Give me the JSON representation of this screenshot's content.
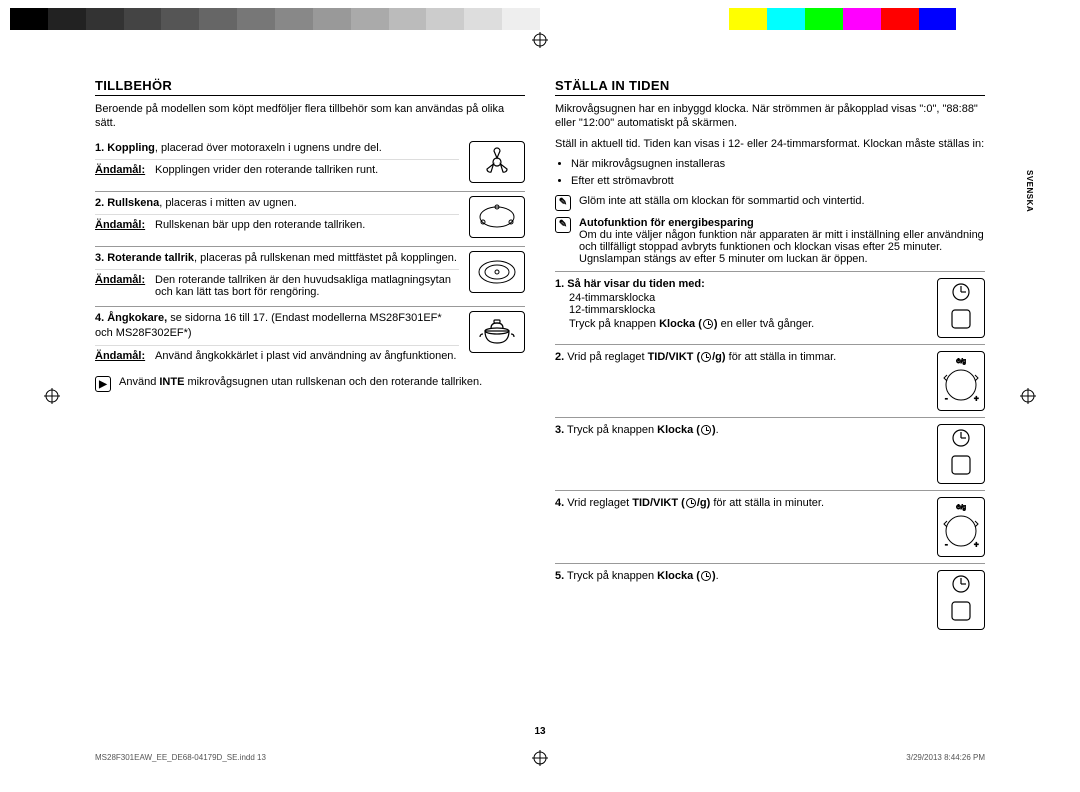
{
  "colorbar": [
    "#000",
    "#222",
    "#333",
    "#444",
    "#555",
    "#666",
    "#777",
    "#888",
    "#999",
    "#aaa",
    "#bbb",
    "#ccc",
    "#ddd",
    "#eee",
    "#fff",
    "#fff",
    "#fff",
    "#fff",
    "#fff",
    "#ff0",
    "#0ff",
    "#0f0",
    "#f0f",
    "#f00",
    "#00f",
    "#fff",
    "#fff",
    "#fff"
  ],
  "left": {
    "title": "TILLBEHÖR",
    "intro": "Beroende på modellen som köpt medföljer flera tillbehör som kan användas på olika sätt.",
    "items": [
      {
        "num": "1.",
        "head_bold": "Koppling",
        "head_rest": ", placerad över motoraxeln i ugnens undre del.",
        "purpose_label": "Ändamål:",
        "purpose_text": "Kopplingen vrider den roterande tallriken runt."
      },
      {
        "num": "2.",
        "head_bold": "Rullskena",
        "head_rest": ", placeras i mitten av ugnen.",
        "purpose_label": "Ändamål:",
        "purpose_text": "Rullskenan bär upp den roterande tallriken."
      },
      {
        "num": "3.",
        "head_bold": "Roterande tallrik",
        "head_rest": ", placeras på rullskenan med mittfästet på kopplingen.",
        "purpose_label": "Ändamål:",
        "purpose_text": "Den roterande tallriken är den huvudsakliga matlagningsytan och kan lätt tas bort för rengöring."
      },
      {
        "num": "4.",
        "head_bold": "Ångkokare,",
        "head_rest": " se sidorna 16 till 17. (Endast modellerna MS28F301EF* och MS28F302EF*)",
        "purpose_label": "Ändamål:",
        "purpose_text": "Använd ångkokkärlet i plast vid användning av ångfunktionen."
      }
    ],
    "warning_prefix": "Använd ",
    "warning_bold": "INTE",
    "warning_rest": " mikrovågsugnen utan rullskenan och den roterande tallriken."
  },
  "right": {
    "title": "STÄLLA IN TIDEN",
    "intro1": "Mikrovågsugnen har en inbyggd klocka. När strömmen är påkopplad visas \":0\", \"88:88\" eller \"12:00\" automatiskt på skärmen.",
    "intro2": "Ställ in aktuell tid. Tiden kan visas i 12- eller 24-timmarsformat. Klockan måste ställas in:",
    "bullets": [
      "När mikrovågsugnen installeras",
      "Efter ett strömavbrott"
    ],
    "note1": "Glöm inte att ställa om klockan för sommartid och vintertid.",
    "note2_title": "Autofunktion för energibesparing",
    "note2_body": "Om du inte väljer någon funktion när apparaten är mitt i inställning eller användning och tillfälligt stoppad avbryts funktionen och klockan visas efter 25 minuter. Ugnslampan stängs av efter 5 minuter om luckan är öppen.",
    "steps": [
      {
        "num": "1.",
        "bold": "Så här visar du tiden med:",
        "lines": "24-timmarsklocka\n12-timmarsklocka",
        "tail_pre": "Tryck på knappen ",
        "tail_bold": "Klocka (",
        "tail_post": ") en eller två gånger.",
        "panel": "buttons"
      },
      {
        "num": "2.",
        "pre": "Vrid på reglaget ",
        "bold": "TID/VIKT (",
        "post": ") för att ställa in timmar.",
        "panel": "knob"
      },
      {
        "num": "3.",
        "pre": "Tryck på knappen ",
        "bold": "Klocka (",
        "post": ").",
        "panel": "buttons"
      },
      {
        "num": "4.",
        "pre": "Vrid reglaget ",
        "bold": "TID/VIKT (",
        "post": ") för att ställa in minuter.",
        "panel": "knob"
      },
      {
        "num": "5.",
        "pre": "Tryck på knappen ",
        "bold": "Klocka (",
        "post": ").",
        "panel": "buttons"
      }
    ]
  },
  "side_lang": "SVENSKA",
  "page_num": "13",
  "footer_left": "MS28F301EAW_EE_DE68-04179D_SE.indd   13",
  "footer_right": "3/29/2013   8:44:26 PM"
}
